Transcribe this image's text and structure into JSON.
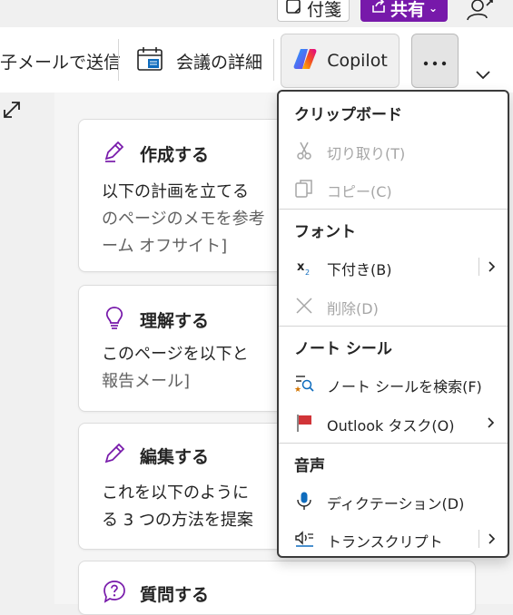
{
  "topbar": {
    "sticky_label": "付箋",
    "share_label": "共有"
  },
  "ribbon": {
    "email_label": "子メールで送信",
    "meeting_label": "会議の詳細",
    "copilot_label": "Copilot",
    "more_icon": "more-horizontal-icon",
    "collapse_icon": "chevron-down-icon"
  },
  "cards": [
    {
      "title": "作成する",
      "icon": "pen-edit-icon",
      "line1": "以下の計画を立てる",
      "line2": "のページのメモを参考",
      "line3": "ーム オフサイト]"
    },
    {
      "title": "理解する",
      "icon": "lightbulb-icon",
      "line1": "このページを以下と",
      "line2": "報告メール]"
    },
    {
      "title": "編集する",
      "icon": "pencil-icon",
      "line1": "これを以下のように",
      "line2": "る 3 つの方法を提案"
    },
    {
      "title": "質問する",
      "icon": "question-bubble-icon"
    }
  ],
  "menu": {
    "sections": [
      {
        "header": "クリップボード",
        "items": [
          {
            "label": "切り取り(T)",
            "icon": "scissors-icon",
            "enabled": false,
            "submenu": false
          },
          {
            "label": "コピー(C)",
            "icon": "copy-icon",
            "enabled": false,
            "submenu": false
          }
        ]
      },
      {
        "header": "フォント",
        "items": [
          {
            "label": "下付き(B)",
            "icon": "subscript-icon",
            "enabled": true,
            "submenu": true
          },
          {
            "label": "削除(D)",
            "icon": "delete-x-icon",
            "enabled": false,
            "submenu": false
          }
        ]
      },
      {
        "header": "ノート シール",
        "items": [
          {
            "label": "ノート シールを検索(F)",
            "icon": "tag-search-icon",
            "enabled": true,
            "submenu": false
          },
          {
            "label": "Outlook タスク(O)",
            "icon": "red-flag-icon",
            "enabled": true,
            "submenu": true
          }
        ]
      },
      {
        "header": "音声",
        "items": [
          {
            "label": "ディクテーション(D)",
            "icon": "microphone-icon",
            "enabled": true,
            "submenu": false
          },
          {
            "label": "トランスクリプト",
            "icon": "transcript-icon",
            "enabled": true,
            "submenu": true
          }
        ]
      }
    ]
  },
  "colors": {
    "accent": "#7719aa",
    "card_icon": "#7719aa",
    "flag": "#d13438",
    "mic": "#0f6cbd"
  }
}
